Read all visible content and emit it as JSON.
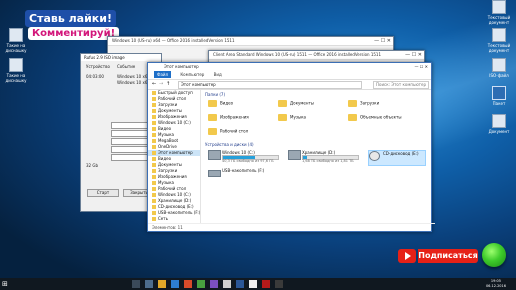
{
  "promo": {
    "line1": "Ставь лайки!",
    "line2": "Комментируй!"
  },
  "desktop_icons": {
    "left": [
      {
        "label": "Такие на диснашку"
      },
      {
        "label": "Такие на диснашку"
      }
    ],
    "right": [
      {
        "label": "Текстовый документ"
      },
      {
        "label": "Текстовый документ"
      },
      {
        "label": "ISO-файл"
      },
      {
        "label": "Пакет"
      },
      {
        "label": "Документ"
      }
    ]
  },
  "bg_windows": {
    "w1_title": "Windows 10 (US-ru) x64 — Office 2016 installedVersion 1511",
    "w2_title": "Client Area Standard Windows 10 (US-ru) 1511 — Office 2016 installedVersion 1511"
  },
  "rufus": {
    "title": "Rufus 2.9 ISO image",
    "col1": "Устройство",
    "col2": "Событие",
    "line1": "04:03:00",
    "line2": "Windows 10 x64",
    "line3": "Windows 10 x64 ISO",
    "disk_size": "32 Gb",
    "btn_start": "Старт",
    "btn_close": "Закрыть"
  },
  "explorer": {
    "title": "Этот компьютер",
    "ribbon": [
      "Файл",
      "Компьютер",
      "Вид"
    ],
    "address": "Этот компьютер",
    "search_placeholder": "Поиск: Этот компьютер",
    "nav": [
      {
        "label": "Быстрый доступ",
        "selected": false
      },
      {
        "label": "Рабочий стол",
        "selected": false
      },
      {
        "label": "Загрузки",
        "selected": false
      },
      {
        "label": "Документы",
        "selected": false
      },
      {
        "label": "Изображения",
        "selected": false
      },
      {
        "label": "Windows 10 (C:)",
        "selected": false
      },
      {
        "label": "Видео",
        "selected": false
      },
      {
        "label": "Музыка",
        "selected": false
      },
      {
        "label": "MegaBoot",
        "selected": false
      },
      {
        "label": "OneDrive",
        "selected": false
      },
      {
        "label": "Этот компьютер",
        "selected": true
      },
      {
        "label": "Видео",
        "selected": false
      },
      {
        "label": "Документы",
        "selected": false
      },
      {
        "label": "Загрузки",
        "selected": false
      },
      {
        "label": "Изображения",
        "selected": false
      },
      {
        "label": "Музыка",
        "selected": false
      },
      {
        "label": "Рабочий стол",
        "selected": false
      },
      {
        "label": "Windows 10 (C:)",
        "selected": false
      },
      {
        "label": "Хранилище (D:)",
        "selected": false
      },
      {
        "label": "CD-дисковод (E:)",
        "selected": false
      },
      {
        "label": "USB-накопитель (F:)",
        "selected": false
      },
      {
        "label": "Сеть",
        "selected": false
      }
    ],
    "folders_header": "Папки (7)",
    "folders": [
      "Видео",
      "Документы",
      "Загрузки",
      "Изображения",
      "Музыка",
      "Объемные объекты",
      "Рабочий стол"
    ],
    "drives_header": "Устройства и диски (4)",
    "drives": [
      {
        "name": "Windows 10 (C:)",
        "free": "40,3 ГБ свободно из 97,6 ГБ",
        "used": 0.59,
        "selected": false
      },
      {
        "name": "Хранилище (D:)",
        "free": "1,68 ТБ свободно из 1,81 ТБ",
        "used": 0.07,
        "selected": false
      },
      {
        "name": "CD-дисковод (E:)",
        "free": "",
        "used": null,
        "selected": true
      },
      {
        "name": "USB-накопитель (F:)",
        "free": "",
        "used": null,
        "selected": false
      }
    ],
    "status": "Элементов: 11"
  },
  "taskbar": {
    "time": "19:05",
    "date": "06.12.2016"
  },
  "subscribe": {
    "label": "Подписаться"
  }
}
